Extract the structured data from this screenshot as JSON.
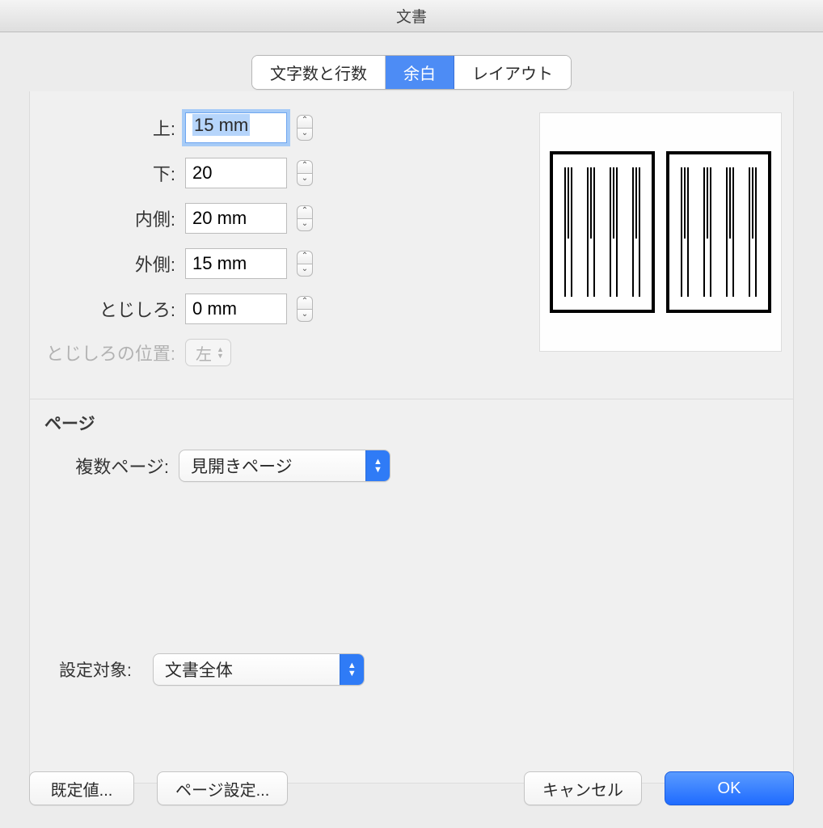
{
  "window": {
    "title": "文書"
  },
  "tabs": {
    "chars_lines": "文字数と行数",
    "margins": "余白",
    "layout": "レイアウト",
    "active": "margins"
  },
  "margins": {
    "top_label": "上:",
    "top_value": "15 mm",
    "bottom_label": "下:",
    "bottom_value": "20",
    "inner_label": "内側:",
    "inner_value": "20 mm",
    "outer_label": "外側:",
    "outer_value": "15 mm",
    "gutter_label": "とじしろ:",
    "gutter_value": "0 mm",
    "gutter_pos_label": "とじしろの位置:",
    "gutter_pos_value": "左"
  },
  "page_section": {
    "title": "ページ",
    "multi_label": "複数ページ:",
    "multi_value": "見開きページ"
  },
  "apply": {
    "label": "設定対象:",
    "value": "文書全体"
  },
  "buttons": {
    "defaults": "既定値...",
    "page_setup": "ページ設定...",
    "cancel": "キャンセル",
    "ok": "OK"
  }
}
